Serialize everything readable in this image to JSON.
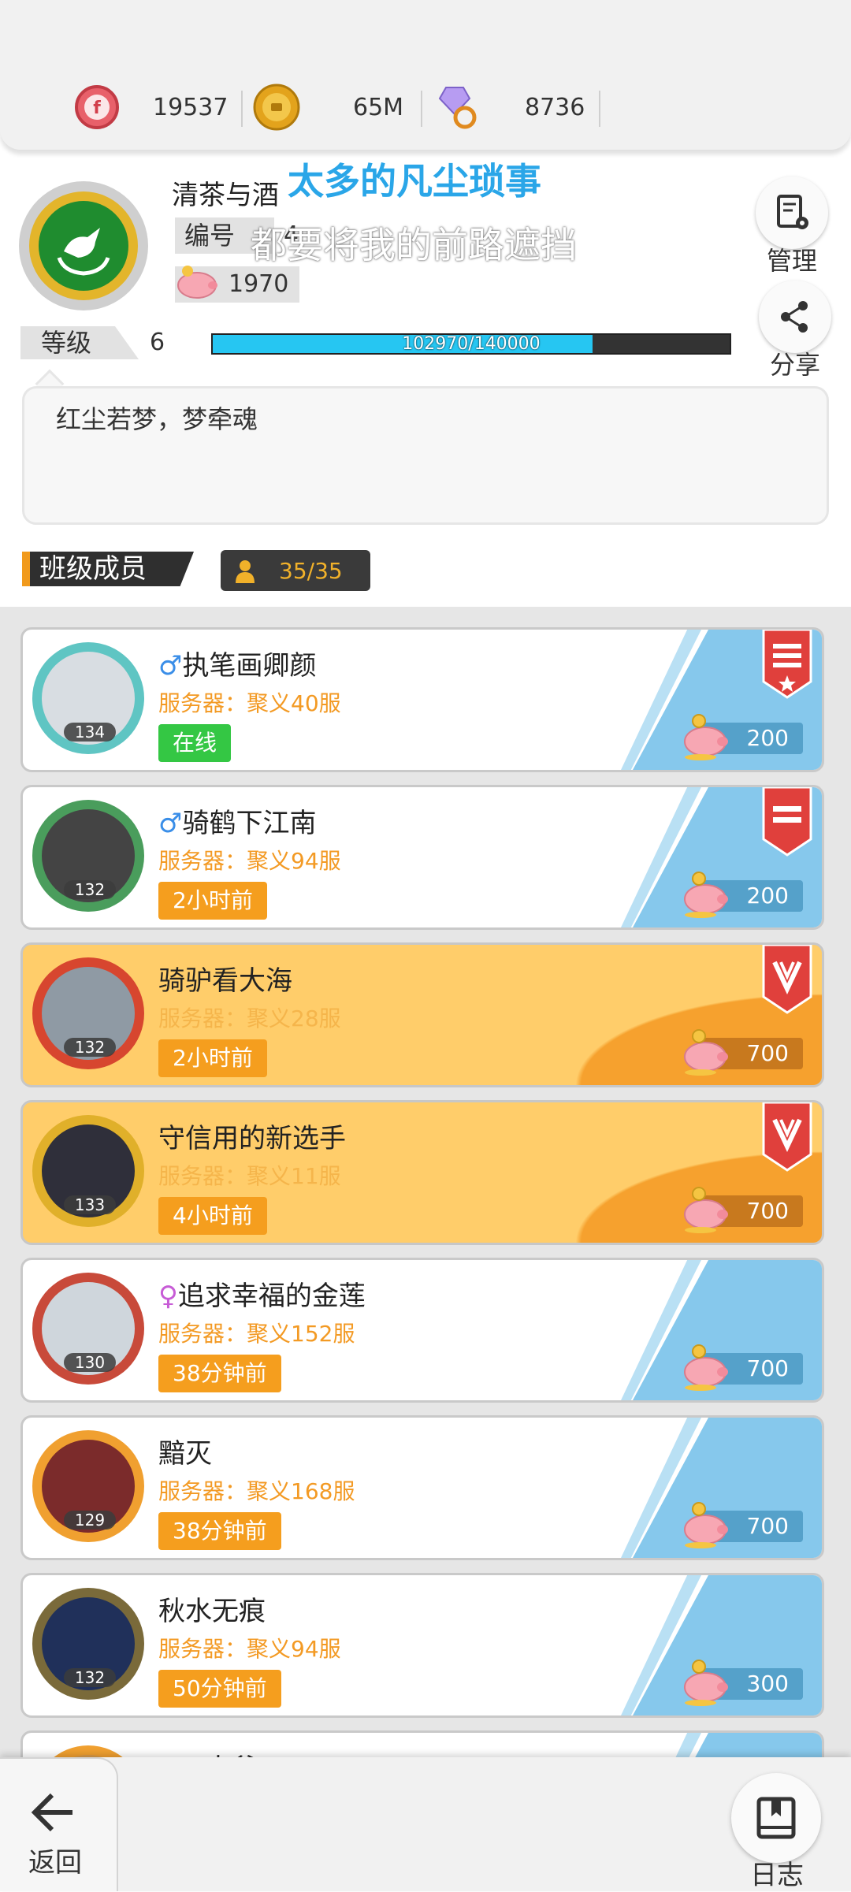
{
  "currency": {
    "ruby": {
      "icon": "ruby-token-icon",
      "value": "19537"
    },
    "gold": {
      "icon": "gold-coin-icon",
      "value": "65M"
    },
    "gem": {
      "icon": "diamond-pacifier-icon",
      "value": "8736"
    }
  },
  "profile": {
    "name": "清茶与酒",
    "lyric_line1": "太多的凡尘琐事",
    "lyric_line2": "都要将我的前路遮挡",
    "id_label": "编号",
    "id_value": "4",
    "coins": "1970",
    "level_label": "等级",
    "level": "6",
    "xp_text": "102970/140000",
    "xp_fraction": 0.7355,
    "motto": "红尘若梦，梦牵魂"
  },
  "actions": {
    "manage": "管理",
    "share": "分享",
    "back": "返回",
    "log": "日志"
  },
  "members_section": {
    "title": "班级成员",
    "count": "35/35"
  },
  "members": [
    {
      "gender": "♂",
      "name": "执笔画卿颜",
      "server": "服务器：聚义40服",
      "status": "在线",
      "online": true,
      "level": "134",
      "points": "200",
      "gold": false,
      "badge": "rank-badge-star"
    },
    {
      "gender": "♂",
      "name": "骑鹤下江南",
      "server": "服务器：聚义94服",
      "status": "2小时前",
      "online": false,
      "level": "132",
      "points": "200",
      "gold": false,
      "badge": "rank-badge-bars"
    },
    {
      "gender": "",
      "name": "骑驴看大海",
      "server": "服务器：聚义28服",
      "status": "2小时前",
      "online": false,
      "level": "132",
      "points": "700",
      "gold": true,
      "badge": "rank-badge-chevron"
    },
    {
      "gender": "",
      "name": "守信用的新选手",
      "server": "服务器：聚义11服",
      "status": "4小时前",
      "online": false,
      "level": "133",
      "points": "700",
      "gold": true,
      "badge": "rank-badge-chevron"
    },
    {
      "gender": "♀",
      "name": "追求幸福的金莲",
      "server": "服务器：聚义152服",
      "status": "38分钟前",
      "online": false,
      "level": "130",
      "points": "700",
      "gold": false,
      "badge": ""
    },
    {
      "gender": "",
      "name": "黯灭",
      "server": "服务器：聚义168服",
      "status": "38分钟前",
      "online": false,
      "level": "129",
      "points": "700",
      "gold": false,
      "badge": ""
    },
    {
      "gender": "",
      "name": "秋水无痕",
      "server": "服务器：聚义94服",
      "status": "50分钟前",
      "online": false,
      "level": "132",
      "points": "300",
      "gold": false,
      "badge": ""
    },
    {
      "gender": "♀",
      "name": "二大爷",
      "server": "",
      "status": "",
      "online": false,
      "level": "",
      "points": "",
      "gold": false,
      "badge": ""
    }
  ],
  "colors": {
    "accent_orange": "#f59e1e",
    "online_green": "#34c744",
    "xp_blue": "#26c6f2",
    "lyric_blue": "#2aa6e8"
  }
}
